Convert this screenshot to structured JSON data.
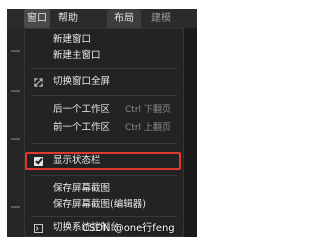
{
  "menubar": {
    "window": "窗口",
    "help": "帮助",
    "layout": "布局",
    "model": "建模"
  },
  "menu": {
    "items": [
      {
        "label": "新建窗口",
        "icon": ""
      },
      {
        "label": "新建主窗口",
        "icon": ""
      },
      {
        "label": "切换窗口全屏",
        "icon": "fullscreen-icon"
      },
      {
        "label": "后一个工作区",
        "shortcut": "Ctrl 下翻页"
      },
      {
        "label": "前一个工作区",
        "shortcut": "Ctrl 上翻页"
      },
      {
        "label": "显示状态栏",
        "icon": "checkbox-checked-icon",
        "checked": true
      },
      {
        "label": "保存屏幕截图"
      },
      {
        "label": "保存屏幕截图(编辑器)"
      },
      {
        "label": "切换系统控制台",
        "icon": "console-icon"
      }
    ]
  },
  "highlight_color": "#e03a2e",
  "watermark": "CSDN @one行feng"
}
